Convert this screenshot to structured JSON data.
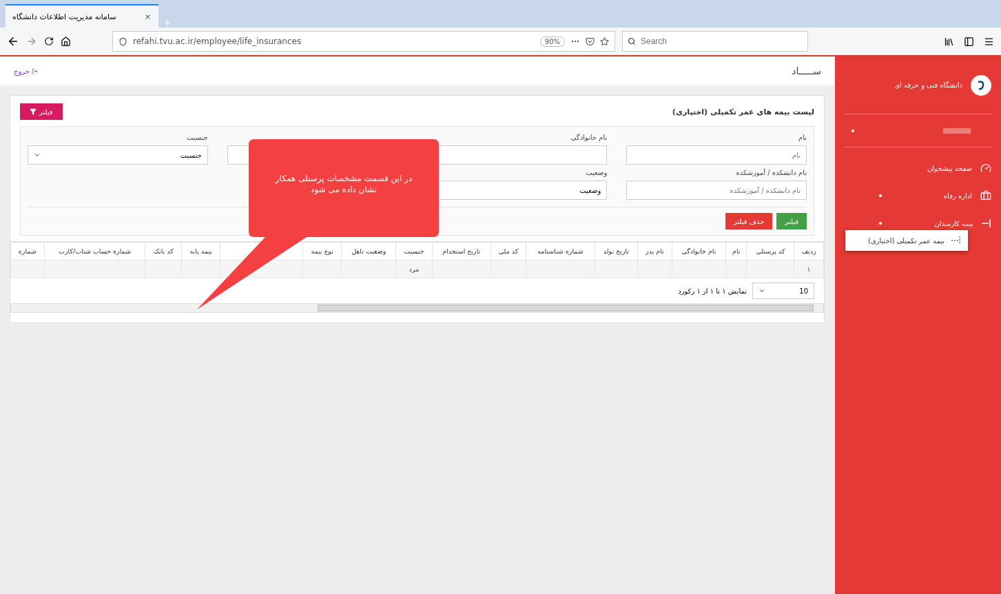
{
  "browser": {
    "tab_title": "سامانه مدیریت اطلاعات دانشگاه",
    "url": "refahi.tvu.ac.ir/employee/life_insurances",
    "zoom": "90%",
    "search_placeholder": "Search"
  },
  "header": {
    "brand": "ســـــاد",
    "logout": "خروج"
  },
  "sidebar": {
    "org_name": "دانشگاه فنی و حرفه ای",
    "items": [
      {
        "label": "صفحه پیشخوان",
        "expandable": false
      },
      {
        "label": "اداره رفاه",
        "expandable": true
      },
      {
        "label": "بیمه کارمندان",
        "expandable": true
      }
    ],
    "popout_item": "بیمه عمر تکمیلی (اختیاری)"
  },
  "page": {
    "title": "لیست بیمه های عمر تکمیلی (اختیاری)",
    "filter_toggle": "فیلتر"
  },
  "filters": [
    {
      "kind": "text",
      "label": "نام",
      "placeholder": "نام"
    },
    {
      "kind": "text",
      "label": "نام خانوادگی"
    },
    {
      "kind": "text"
    },
    {
      "kind": "select",
      "label": "جنسیت",
      "value": "جنسیت"
    },
    {
      "kind": "text",
      "label": "نام دانشکده / آموزشکده",
      "placeholder": "نام دانشکده / آموزشکده"
    },
    {
      "kind": "select",
      "label": "وضعیت",
      "value": "وضعیت"
    }
  ],
  "filter_buttons": [
    {
      "kind": "apply",
      "label": "فیلتر"
    },
    {
      "kind": "clear",
      "label": "حذف فیلتر"
    }
  ],
  "table": {
    "columns": [
      "ردیف",
      "کد پرسنلی",
      "نام",
      "نام خانوادگی",
      "نام پدر",
      "تاریخ تولد",
      "شماره شناسنامه",
      "کد ملی",
      "تاریخ استخدام",
      "جنسیت",
      "وضعیت تاهل",
      "نوع بیمه",
      "",
      "بیمه پایه",
      "کد بانک",
      "شماره حساب شتاب/کارت",
      "شماره"
    ],
    "rows": [
      [
        "۱",
        "",
        "",
        "",
        "",
        "",
        "",
        "",
        "",
        "مرد",
        "",
        "",
        "",
        "",
        "",
        "",
        ""
      ]
    ],
    "page_size": "10",
    "summary": "نمایش ۱ تا ۱ از ۱ رکورد"
  },
  "callout": {
    "text": "در این قسمت مشخصات پرسنلی همکار نشان داده می شود"
  }
}
